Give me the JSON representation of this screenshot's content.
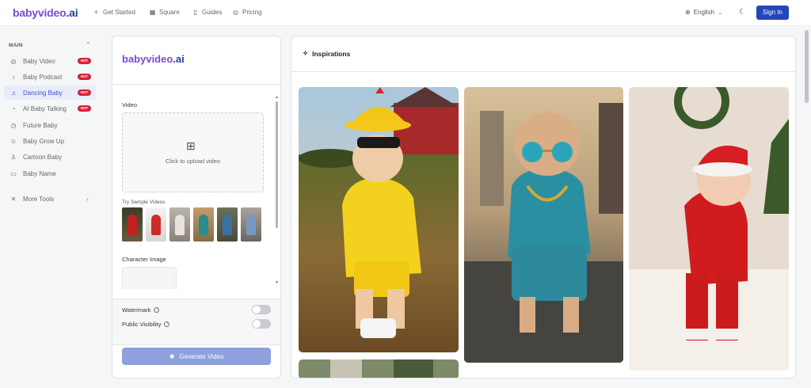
{
  "brand": {
    "prefix": "babyvideo",
    "suffix": ".ai"
  },
  "nav": [
    {
      "label": "Get Started",
      "icon": "sparkle-icon"
    },
    {
      "label": "Square",
      "icon": "grid-icon"
    },
    {
      "label": "Guides",
      "icon": "book-icon"
    },
    {
      "label": "Pricing",
      "icon": "coin-icon"
    }
  ],
  "header": {
    "language": "English",
    "sign_in": "Sign In"
  },
  "sidebar": {
    "section": "MAIN",
    "items": [
      {
        "label": "Baby Video",
        "icon": "video-icon",
        "badge": "HOT"
      },
      {
        "label": "Baby Podcast",
        "icon": "microphone-icon",
        "badge": "HOT"
      },
      {
        "label": "Dancing Baby",
        "icon": "music-icon",
        "badge": "HOT",
        "active": true
      },
      {
        "label": "AI Baby Talking",
        "icon": "speech-icon",
        "badge": "HOT"
      },
      {
        "label": "Future Baby",
        "icon": "clock-icon"
      },
      {
        "label": "Baby Grow Up",
        "icon": "smile-icon"
      },
      {
        "label": "Cartoon Baby",
        "icon": "user-icon"
      },
      {
        "label": "Baby Name",
        "icon": "name-icon"
      }
    ],
    "more": "More Tools"
  },
  "form": {
    "video_label": "Video",
    "upload_text": "Click to upload video",
    "samples_label": "Try Sample Videos",
    "character_label": "Character Image",
    "watermark_label": "Watermark",
    "visibility_label": "Public Visibility",
    "generate_label": "Generate Video",
    "watermark_on": false,
    "public_on": false
  },
  "inspirations": {
    "title": "Inspirations"
  },
  "colors": {
    "accent": "#2447b8",
    "active_bg": "#e8ecfb",
    "hot_badge": "#d4233a",
    "generate": "#8fa0dd"
  }
}
